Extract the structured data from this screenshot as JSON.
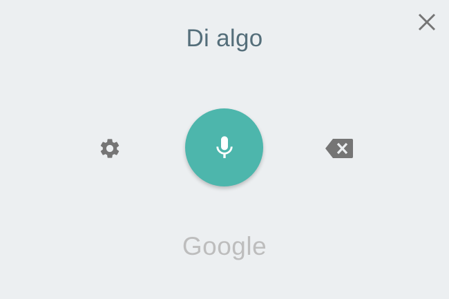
{
  "dialog": {
    "prompt": "Di algo",
    "brand": "Google"
  },
  "icons": {
    "close": "close-icon",
    "settings": "gear-icon",
    "microphone": "microphone-icon",
    "backspace": "backspace-icon"
  },
  "colors": {
    "background": "#eceff1",
    "mic_button": "#4db6ac",
    "prompt_text": "#546e7a",
    "icon_gray": "#757575",
    "brand_text": "#bdbdbd"
  }
}
